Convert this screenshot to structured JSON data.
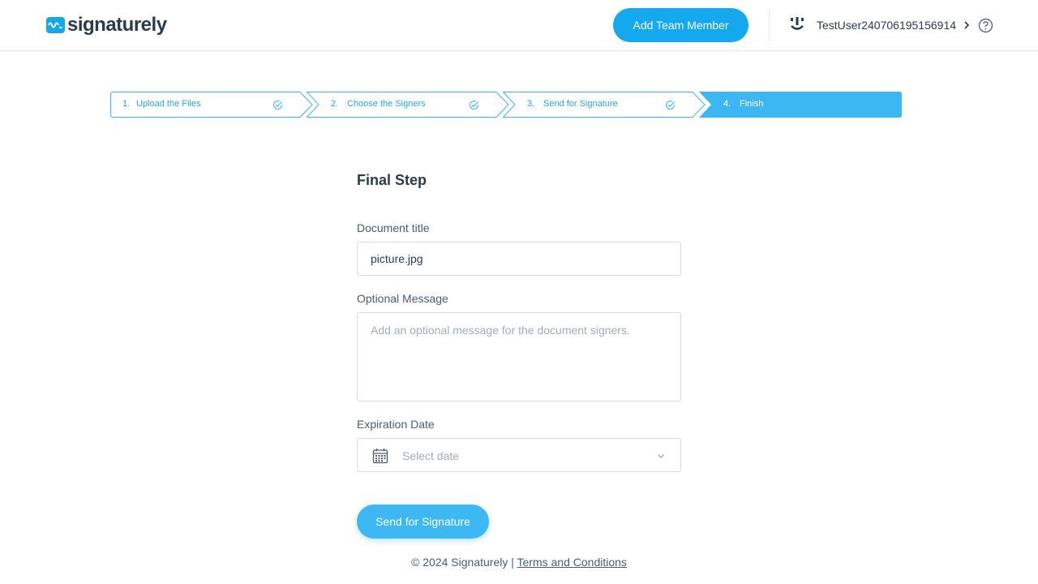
{
  "header": {
    "logo_text": "signaturely",
    "add_team_member_label": "Add Team Member",
    "user_name": "TestUser240706195156914"
  },
  "steps": [
    {
      "number": "1.",
      "label": "Upload the Files",
      "completed": true
    },
    {
      "number": "2.",
      "label": "Choose the Signers",
      "completed": true
    },
    {
      "number": "3.",
      "label": "Send for Signature",
      "completed": true
    },
    {
      "number": "4.",
      "label": "Finish",
      "active": true
    }
  ],
  "form": {
    "title": "Final Step",
    "document_title_label": "Document title",
    "document_title_value": "picture.jpg",
    "message_label": "Optional Message",
    "message_placeholder": "Add an optional message for the document signers.",
    "expiration_label": "Expiration Date",
    "expiration_placeholder": "Select date",
    "send_button_label": "Send for Signature"
  },
  "footer": {
    "copyright": "© 2024 Signaturely |",
    "terms_link": "Terms and Conditions"
  },
  "colors": {
    "accent": "#14a8ee",
    "step_active": "#3db7f4",
    "text_dark": "#2b3a4d"
  }
}
